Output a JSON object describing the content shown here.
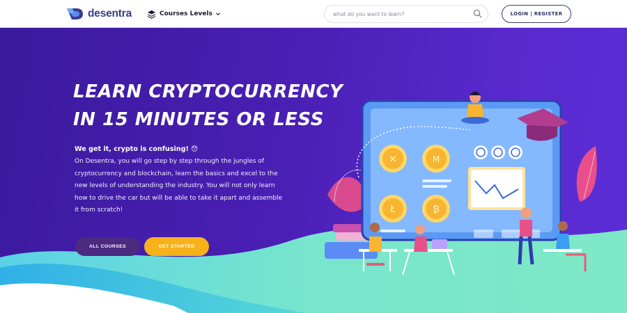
{
  "navbar": {
    "brand": "desentra",
    "courses_label": "Courses Levels",
    "search_placeholder": "what do you want to learn?",
    "login_label": "LOGIN | REGISTER"
  },
  "hero": {
    "headline_line1": "LEARN CRYPTOCURRENCY",
    "headline_line2": "IN 15 MINUTES OR LESS",
    "lead": "We get it, crypto is confusing! 😯",
    "body": "On Desentra, you will go step by step through the jungles of cryptocurrency and blockchain, learn the basics and excel to the new levels of understanding the industry. You will not only learn how to drive the car but will be able to take it apart and assemble it from scratch!",
    "all_courses_label": "ALL COURSES",
    "get_started_label": "GET STARTED"
  },
  "icons": {
    "logo": "desentra-logo-icon",
    "courses": "layers-icon",
    "dropdown": "chevron-down-icon",
    "search": "search-icon"
  },
  "colors": {
    "brand": "#3a3d8f",
    "hero_background": "#4a1fb4",
    "accent_button": "#f7b21b",
    "secondary_button": "#4b2a80",
    "wave_teal": "#6fe0c8"
  }
}
